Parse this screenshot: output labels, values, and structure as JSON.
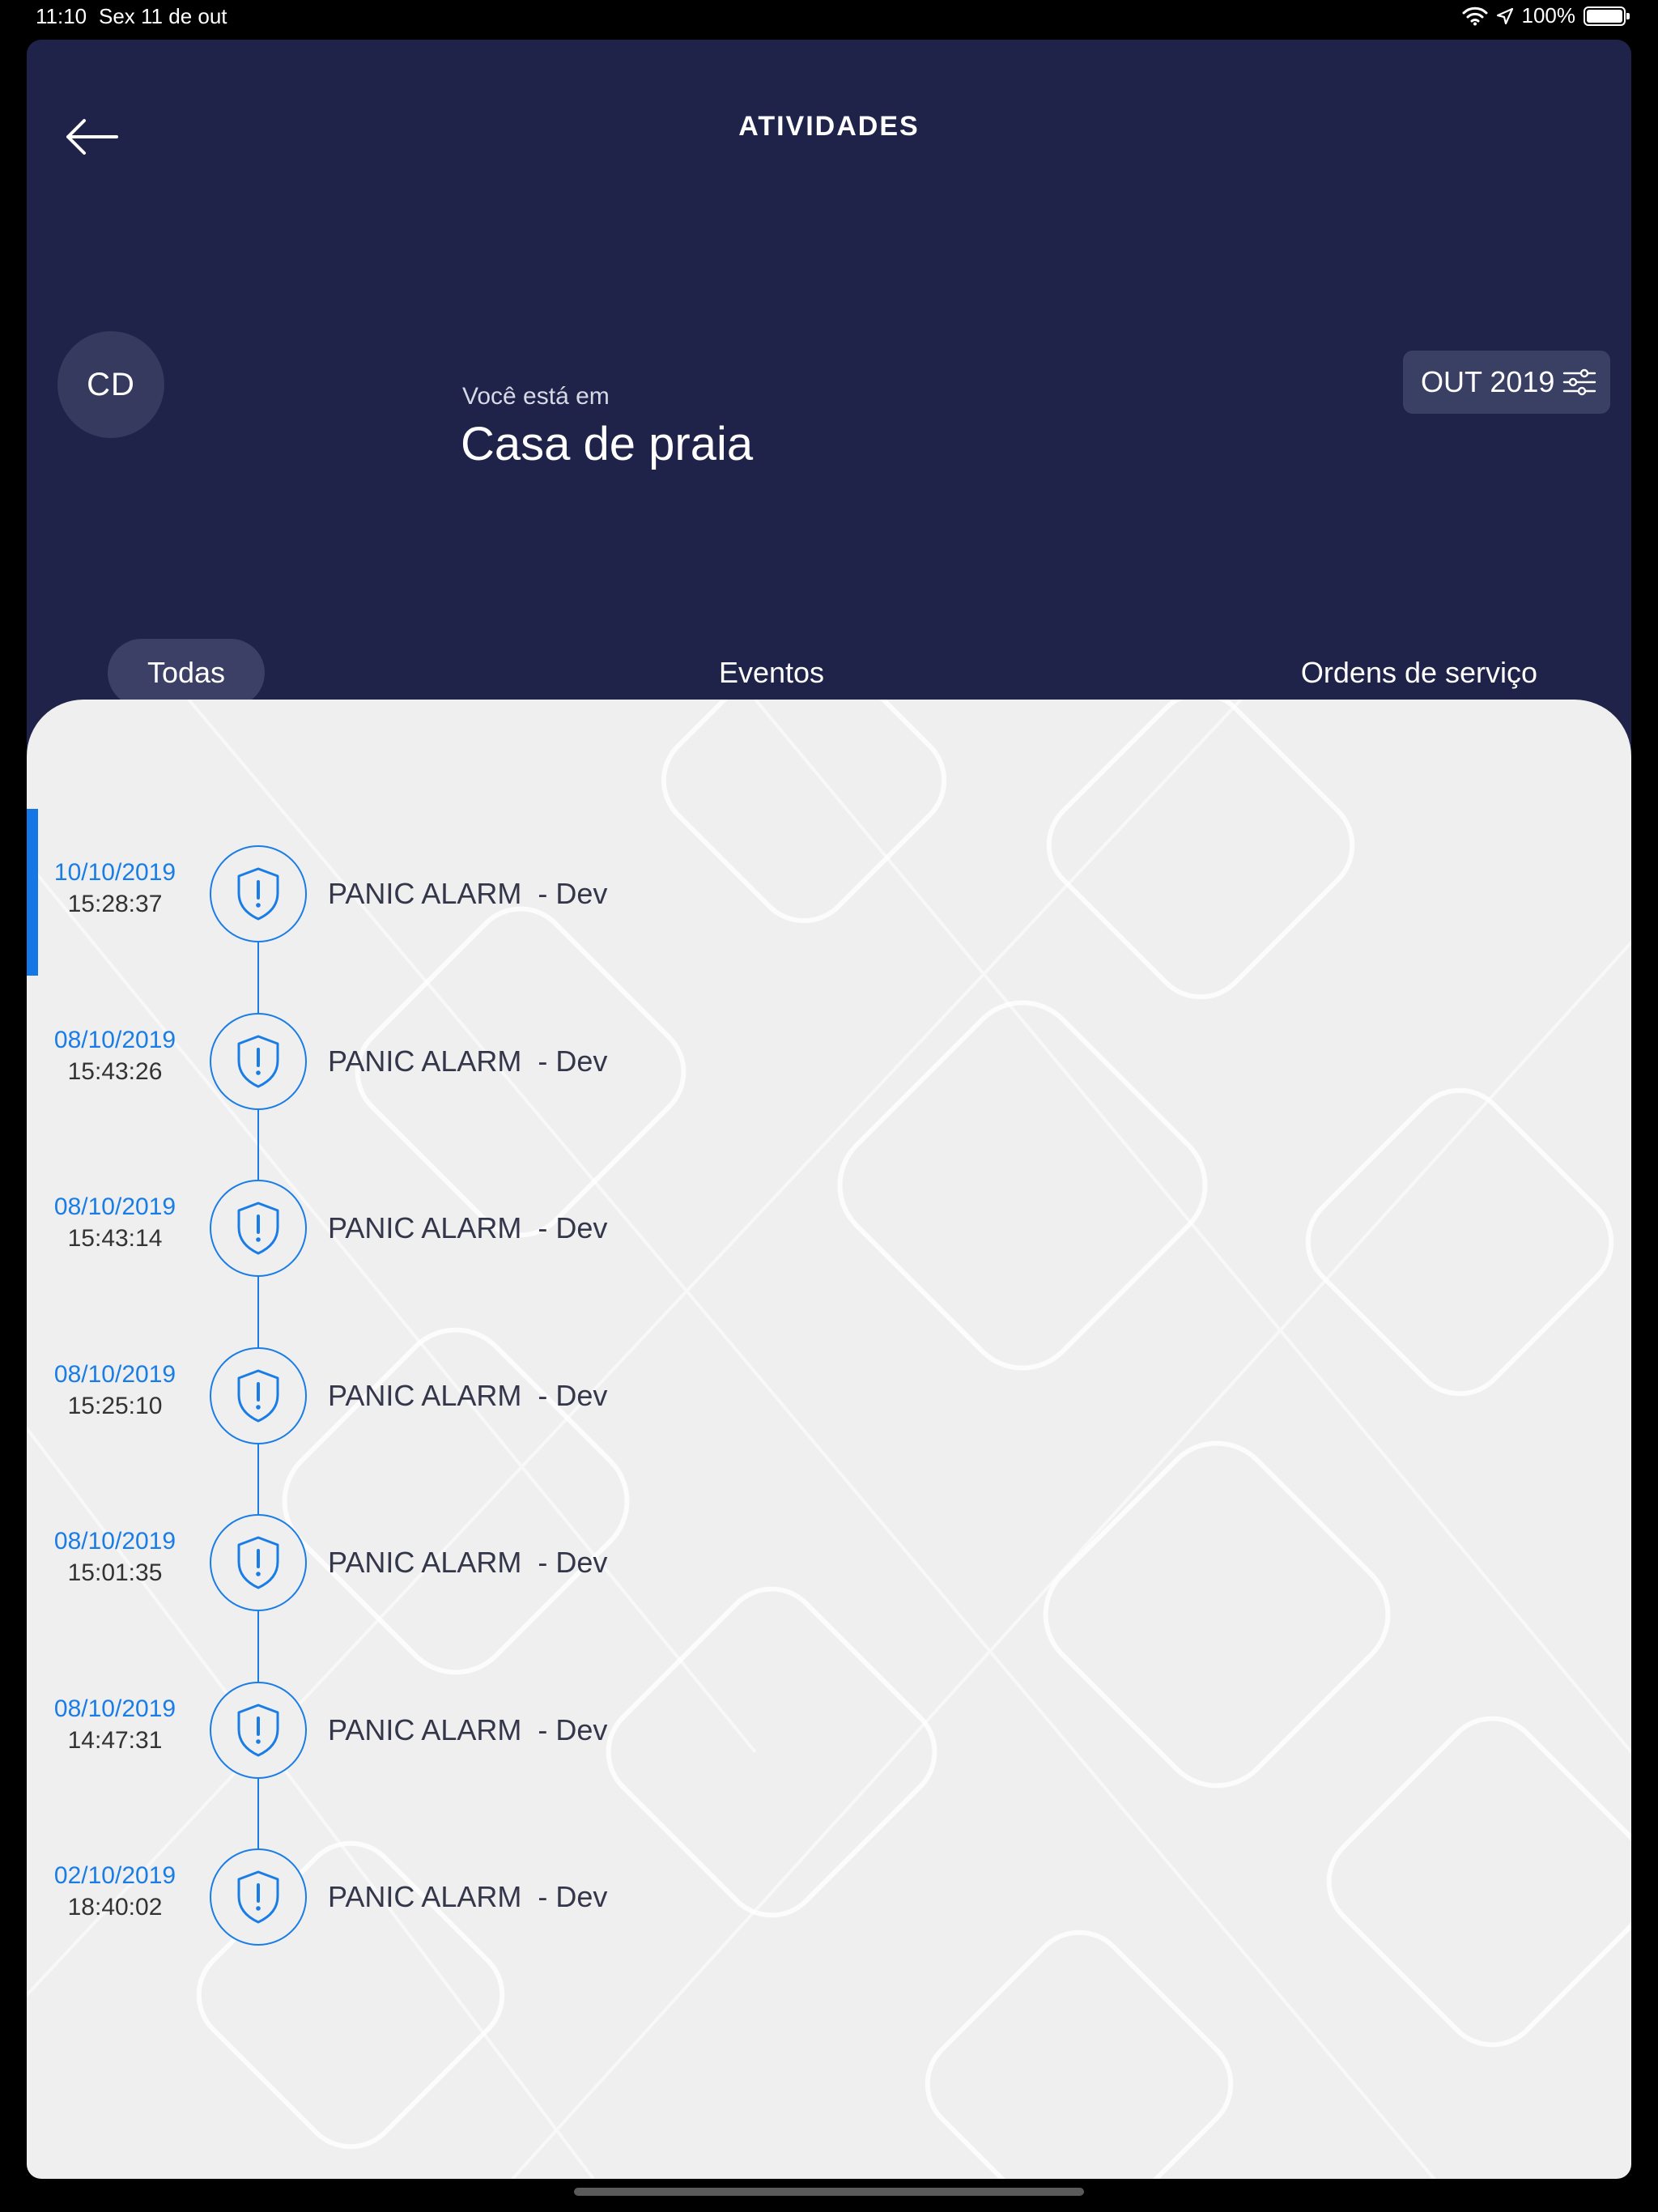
{
  "status_bar": {
    "time": "11:10",
    "date": "Sex 11 de out",
    "battery": "100%"
  },
  "header": {
    "title": "ATIVIDADES"
  },
  "profile": {
    "initials": "CD",
    "location_caption": "Você está em",
    "location_name": "Casa de praia"
  },
  "filter": {
    "period_label": "OUT 2019"
  },
  "tabs": [
    {
      "label": "Todas"
    },
    {
      "label": "Eventos"
    },
    {
      "label": "Ordens de serviço"
    }
  ],
  "events": [
    {
      "date": "10/10/2019",
      "time": "15:28:37",
      "label": "PANIC ALARM  - Dev"
    },
    {
      "date": "08/10/2019",
      "time": "15:43:26",
      "label": "PANIC ALARM  - Dev"
    },
    {
      "date": "08/10/2019",
      "time": "15:43:14",
      "label": "PANIC ALARM  - Dev"
    },
    {
      "date": "08/10/2019",
      "time": "15:25:10",
      "label": "PANIC ALARM  - Dev"
    },
    {
      "date": "08/10/2019",
      "time": "15:01:35",
      "label": "PANIC ALARM  - Dev"
    },
    {
      "date": "08/10/2019",
      "time": "14:47:31",
      "label": "PANIC ALARM  - Dev"
    },
    {
      "date": "02/10/2019",
      "time": "18:40:02",
      "label": "PANIC ALARM  - Dev"
    }
  ],
  "icons": {
    "back": "arrow-left-icon",
    "filter": "sliders-icon",
    "event": "shield-alert-icon"
  },
  "colors": {
    "header_bg": "#1f2249",
    "accent": "#1a7de6",
    "content_bg": "#efeff0"
  }
}
